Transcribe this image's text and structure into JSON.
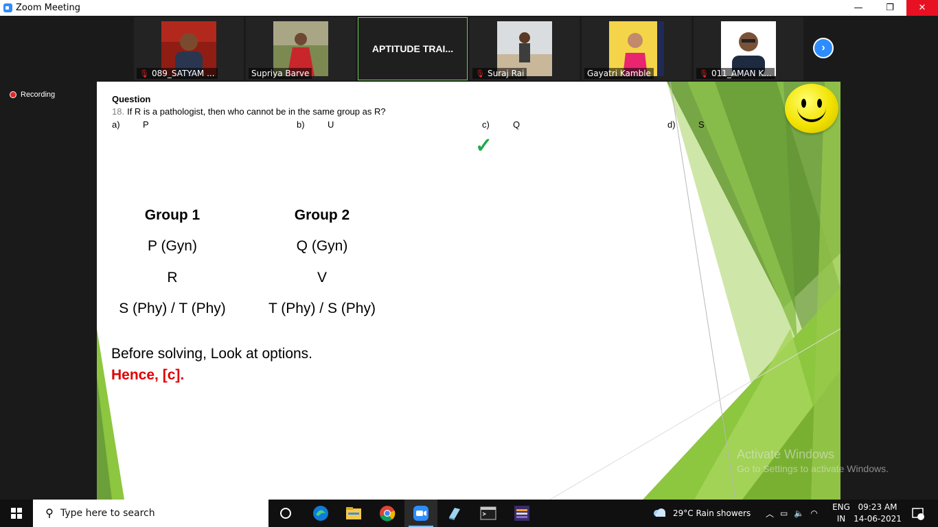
{
  "window": {
    "title": "Zoom Meeting",
    "minimize": "—",
    "maximize": "❐",
    "close": "✕"
  },
  "participants": [
    {
      "name": "089_SATYAM ...",
      "muted": true
    },
    {
      "name": "Supriya Barve",
      "muted": false
    },
    {
      "name": "APTITUDE TRAI...",
      "muted": false,
      "active": true
    },
    {
      "name": "Suraj Rai",
      "muted": true
    },
    {
      "name": "Gayatri Kamble",
      "muted": false
    },
    {
      "name": "011_AMAN K...",
      "muted": true
    }
  ],
  "recording": {
    "label": "Recording"
  },
  "slide": {
    "heading": "Question",
    "question_number": "18.",
    "question_text": "If R is a pathologist, then who cannot be in the same group as R?",
    "options": [
      {
        "label": "a)",
        "value": "P"
      },
      {
        "label": "b)",
        "value": "U"
      },
      {
        "label": "c)",
        "value": "Q"
      },
      {
        "label": "d)",
        "value": "S"
      }
    ],
    "correct_mark": "✓",
    "group1": {
      "title": "Group 1",
      "rows": [
        "P (Gyn)",
        "R",
        "S (Phy) / T (Phy)"
      ]
    },
    "group2": {
      "title": "Group 2",
      "rows": [
        "Q (Gyn)",
        "V",
        "T (Phy) / S (Phy)"
      ]
    },
    "note": "Before solving, Look at options.",
    "answer": "Hence, [c].",
    "colors": {
      "accent_green": "#8dc63f",
      "answer_red": "#e00000",
      "tick_green": "#1faa4a"
    }
  },
  "watermark": {
    "line1": "Activate Windows",
    "line2": "Go to Settings to activate Windows."
  },
  "taskbar": {
    "search_placeholder": "Type here to search",
    "apps": [
      "cortana-icon",
      "edge-icon",
      "file-explorer-icon",
      "chrome-icon",
      "zoom-icon",
      "notepad-icon",
      "terminal-icon",
      "app-icon"
    ],
    "weather": "29°C  Rain showers",
    "lang1": "ENG",
    "lang2": "IN",
    "time": "09:23 AM",
    "date": "14-06-2021",
    "notifications": "1"
  }
}
